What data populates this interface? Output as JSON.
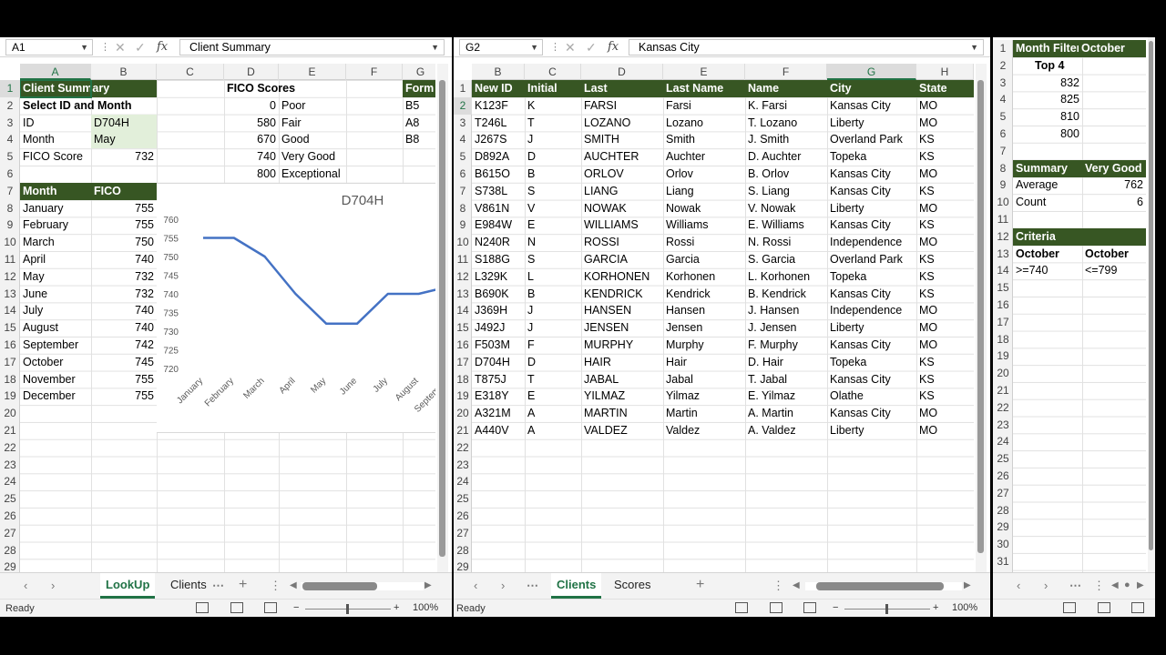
{
  "left": {
    "namebox": "A1",
    "formula": "Client Summary",
    "columns": [
      "A",
      "B",
      "C",
      "D",
      "E",
      "F",
      "G"
    ],
    "rows": [
      "1",
      "2",
      "3",
      "4",
      "5",
      "6",
      "7",
      "8",
      "9",
      "10",
      "11",
      "12",
      "13",
      "14",
      "15",
      "16",
      "17",
      "18",
      "19",
      "20",
      "21",
      "22",
      "23",
      "24",
      "25",
      "26",
      "27",
      "28",
      "29"
    ],
    "title": "Client Summary",
    "select_label": "Select ID and Month",
    "id_label": "ID",
    "id_value": "D704H",
    "month_label": "Month",
    "month_value": "May",
    "fico_label": "FICO Score",
    "fico_value": "732",
    "fico_scores_hdr": "FICO Scores",
    "scores": [
      {
        "min": "0",
        "label": "Poor"
      },
      {
        "min": "580",
        "label": "Fair"
      },
      {
        "min": "670",
        "label": "Good"
      },
      {
        "min": "740",
        "label": "Very Good"
      },
      {
        "min": "800",
        "label": "Exceptional"
      }
    ],
    "form_hdr": "Form",
    "form_vals": [
      "B5",
      "A8",
      "B8"
    ],
    "month_hdr": "Month",
    "fico_hdr": "FICO",
    "months": [
      {
        "m": "January",
        "v": "755"
      },
      {
        "m": "February",
        "v": "755"
      },
      {
        "m": "March",
        "v": "750"
      },
      {
        "m": "April",
        "v": "740"
      },
      {
        "m": "May",
        "v": "732"
      },
      {
        "m": "June",
        "v": "732"
      },
      {
        "m": "July",
        "v": "740"
      },
      {
        "m": "August",
        "v": "740"
      },
      {
        "m": "September",
        "v": "742"
      },
      {
        "m": "October",
        "v": "745"
      },
      {
        "m": "November",
        "v": "755"
      },
      {
        "m": "December",
        "v": "755"
      }
    ],
    "tabs": [
      "LookUp",
      "Clients"
    ],
    "status": "Ready",
    "zoom": "100%"
  },
  "chart_data": {
    "type": "line",
    "title": "D704H",
    "categories": [
      "January",
      "February",
      "March",
      "April",
      "May",
      "June",
      "July",
      "August",
      "September"
    ],
    "values": [
      755,
      755,
      750,
      740,
      732,
      732,
      740,
      740,
      742
    ],
    "yticks": [
      "760",
      "755",
      "750",
      "745",
      "740",
      "735",
      "730",
      "725",
      "720"
    ],
    "ylim": [
      720,
      760
    ],
    "series_color": "#4472c4",
    "grid": false
  },
  "middle": {
    "namebox": "G2",
    "formula": "Kansas City",
    "columns": [
      "B",
      "C",
      "D",
      "E",
      "F",
      "G",
      "H"
    ],
    "rows": [
      "1",
      "2",
      "3",
      "4",
      "5",
      "6",
      "7",
      "8",
      "9",
      "10",
      "11",
      "12",
      "13",
      "14",
      "15",
      "16",
      "17",
      "18",
      "19",
      "20",
      "21",
      "22",
      "23",
      "24",
      "25",
      "26",
      "27",
      "28",
      "29"
    ],
    "headers": [
      "New ID",
      "Initial",
      "Last",
      "Last Name",
      "Name",
      "City",
      "State"
    ],
    "clients": [
      [
        "K123F",
        "K",
        "FARSI",
        "Farsi",
        "K. Farsi",
        "Kansas City",
        "MO"
      ],
      [
        "T246L",
        "T",
        "LOZANO",
        "Lozano",
        "T. Lozano",
        "Liberty",
        "MO"
      ],
      [
        "J267S",
        "J",
        "SMITH",
        "Smith",
        "J. Smith",
        "Overland Park",
        "KS"
      ],
      [
        "D892A",
        "D",
        "AUCHTER",
        "Auchter",
        "D. Auchter",
        "Topeka",
        "KS"
      ],
      [
        "B615O",
        "B",
        "ORLOV",
        "Orlov",
        "B. Orlov",
        "Kansas City",
        "MO"
      ],
      [
        "S738L",
        "S",
        "LIANG",
        "Liang",
        "S. Liang",
        "Kansas City",
        "KS"
      ],
      [
        "V861N",
        "V",
        "NOWAK",
        "Nowak",
        "V. Nowak",
        "Liberty",
        "MO"
      ],
      [
        "E984W",
        "E",
        "WILLIAMS",
        "Williams",
        "E. Williams",
        "Kansas City",
        "KS"
      ],
      [
        "N240R",
        "N",
        "ROSSI",
        "Rossi",
        "N. Rossi",
        "Independence",
        "MO"
      ],
      [
        "S188G",
        "S",
        "GARCIA",
        "Garcia",
        "S. Garcia",
        "Overland Park",
        "KS"
      ],
      [
        "L329K",
        "L",
        "KORHONEN",
        "Korhonen",
        "L. Korhonen",
        "Topeka",
        "KS"
      ],
      [
        "B690K",
        "B",
        "KENDRICK",
        "Kendrick",
        "B. Kendrick",
        "Kansas City",
        "KS"
      ],
      [
        "J369H",
        "J",
        "HANSEN",
        "Hansen",
        "J. Hansen",
        "Independence",
        "MO"
      ],
      [
        "J492J",
        "J",
        "JENSEN",
        "Jensen",
        "J. Jensen",
        "Liberty",
        "MO"
      ],
      [
        "F503M",
        "F",
        "MURPHY",
        "Murphy",
        "F. Murphy",
        "Kansas City",
        "MO"
      ],
      [
        "D704H",
        "D",
        "HAIR",
        "Hair",
        "D. Hair",
        "Topeka",
        "KS"
      ],
      [
        "T875J",
        "T",
        "JABAL",
        "Jabal",
        "T. Jabal",
        "Kansas City",
        "KS"
      ],
      [
        "E318Y",
        "E",
        "YILMAZ",
        "Yilmaz",
        "E. Yilmaz",
        "Olathe",
        "KS"
      ],
      [
        "A321M",
        "A",
        "MARTIN",
        "Martin",
        "A. Martin",
        "Kansas City",
        "MO"
      ],
      [
        "A440V",
        "A",
        "VALDEZ",
        "Valdez",
        "A. Valdez",
        "Liberty",
        "MO"
      ]
    ],
    "tabs": [
      "Clients",
      "Scores"
    ],
    "status": "Ready",
    "zoom": "100%"
  },
  "right": {
    "rows": [
      "1",
      "2",
      "3",
      "4",
      "5",
      "6",
      "7",
      "8",
      "9",
      "10",
      "11",
      "12",
      "13",
      "14",
      "15",
      "16",
      "17",
      "18",
      "19",
      "20",
      "21",
      "22",
      "23",
      "24",
      "25",
      "26",
      "27",
      "28",
      "29",
      "30",
      "31"
    ],
    "month_filter": "Month Filter",
    "month_filter_val": "October",
    "top4": "Top 4",
    "top_vals": [
      "832",
      "825",
      "810",
      "800"
    ],
    "summary": "Summary",
    "summary_val": "Very Good",
    "average": "Average",
    "average_val": "762",
    "count": "Count",
    "count_val": "6",
    "criteria": "Criteria",
    "crit_h1": "October",
    "crit_h2": "October",
    "crit_v1": ">=740",
    "crit_v2": "<=799"
  },
  "colors": {
    "header_green": "#375623",
    "accent": "#217346",
    "light_green": "#e2efda",
    "line_blue": "#4472c4"
  }
}
